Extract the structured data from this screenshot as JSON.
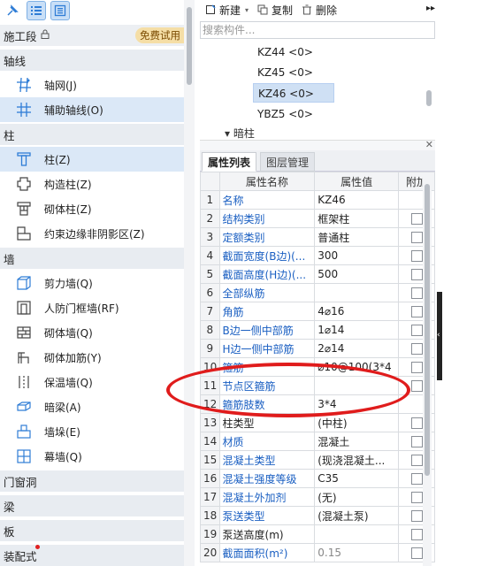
{
  "left": {
    "stage": {
      "label": "施工段",
      "badge": "免费试用"
    },
    "categories": {
      "axis": "轴线",
      "column": "柱",
      "wall": "墙",
      "door": "门窗洞",
      "beam": "梁",
      "slab": "板",
      "assembly": "装配式"
    },
    "axis_items": [
      {
        "label": "轴网(J)",
        "icon": "grid-icon"
      },
      {
        "label": "辅助轴线(O)",
        "icon": "aux-axis-icon"
      }
    ],
    "column_items": [
      {
        "label": "柱(Z)",
        "icon": "column-icon"
      },
      {
        "label": "构造柱(Z)",
        "icon": "constructional-column-icon"
      },
      {
        "label": "砌体柱(Z)",
        "icon": "masonry-column-icon"
      },
      {
        "label": "约束边缘非阴影区(Z)",
        "icon": "boundary-zone-icon"
      }
    ],
    "wall_items": [
      {
        "label": "剪力墙(Q)",
        "icon": "shear-wall-icon"
      },
      {
        "label": "人防门框墙(RF)",
        "icon": "civil-defense-wall-icon"
      },
      {
        "label": "砌体墙(Q)",
        "icon": "masonry-wall-icon"
      },
      {
        "label": "砌体加筋(Y)",
        "icon": "masonry-rebar-icon"
      },
      {
        "label": "保温墙(Q)",
        "icon": "insulation-wall-icon"
      },
      {
        "label": "暗梁(A)",
        "icon": "hidden-beam-icon"
      },
      {
        "label": "墙垛(E)",
        "icon": "wall-pier-icon"
      },
      {
        "label": "幕墙(Q)",
        "icon": "curtain-wall-icon"
      }
    ]
  },
  "toolbar": {
    "new": "新建",
    "copy": "复制",
    "delete": "删除"
  },
  "search": {
    "placeholder": "搜索构件..."
  },
  "tree": {
    "items": [
      "KZ44 <0>",
      "KZ45 <0>",
      "KZ46 <0>",
      "YBZ5 <0>"
    ],
    "selected_index": 2,
    "partial": "▾ 暗柱"
  },
  "props": {
    "tabs": [
      "属性列表",
      "图层管理"
    ],
    "headers": [
      "",
      "属性名称",
      "属性值",
      "附加"
    ],
    "rows": [
      {
        "n": "1",
        "name": "名称",
        "value": "KZ46",
        "blue": true,
        "check": false
      },
      {
        "n": "2",
        "name": "结构类别",
        "value": "框架柱",
        "blue": true,
        "check": true
      },
      {
        "n": "3",
        "name": "定额类别",
        "value": "普通柱",
        "blue": true,
        "check": true
      },
      {
        "n": "4",
        "name": "截面宽度(B边)(...",
        "value": "300",
        "blue": true,
        "check": true
      },
      {
        "n": "5",
        "name": "截面高度(H边)(...",
        "value": "500",
        "blue": true,
        "check": true
      },
      {
        "n": "6",
        "name": "全部纵筋",
        "value": "",
        "blue": true,
        "check": true
      },
      {
        "n": "7",
        "name": "角筋",
        "value": "4⌀16",
        "blue": true,
        "check": true
      },
      {
        "n": "8",
        "name": "B边一侧中部筋",
        "value": "1⌀14",
        "blue": true,
        "check": true
      },
      {
        "n": "9",
        "name": "H边一侧中部筋",
        "value": "2⌀14",
        "blue": true,
        "check": true
      },
      {
        "n": "10",
        "name": "箍筋",
        "value": "⌀10@100(3*4",
        "blue": true,
        "check": true
      },
      {
        "n": "11",
        "name": "节点区箍筋",
        "value": "",
        "blue": true,
        "check": true
      },
      {
        "n": "12",
        "name": "箍筋肢数",
        "value": "3*4",
        "blue": true,
        "check": false
      },
      {
        "n": "13",
        "name": "柱类型",
        "value": "(中柱)",
        "blue": false,
        "check": true
      },
      {
        "n": "14",
        "name": "材质",
        "value": "混凝土",
        "blue": true,
        "check": true
      },
      {
        "n": "15",
        "name": "混凝土类型",
        "value": "(现浇混凝土...",
        "blue": true,
        "check": true
      },
      {
        "n": "16",
        "name": "混凝土强度等级",
        "value": "C35",
        "blue": true,
        "check": true
      },
      {
        "n": "17",
        "name": "混凝土外加剂",
        "value": "(无)",
        "blue": true,
        "check": true
      },
      {
        "n": "18",
        "name": "泵送类型",
        "value": "(混凝土泵)",
        "blue": true,
        "check": true
      },
      {
        "n": "19",
        "name": "泵送高度(m)",
        "value": "",
        "blue": false,
        "check": true
      },
      {
        "n": "20",
        "name": "截面面积(m²)",
        "value": "0.15",
        "blue": true,
        "check": true,
        "gray": true
      }
    ]
  },
  "colors": {
    "accent": "#1a5fc2",
    "selected": "#dbe8f7",
    "annotation": "#e01c1c"
  }
}
